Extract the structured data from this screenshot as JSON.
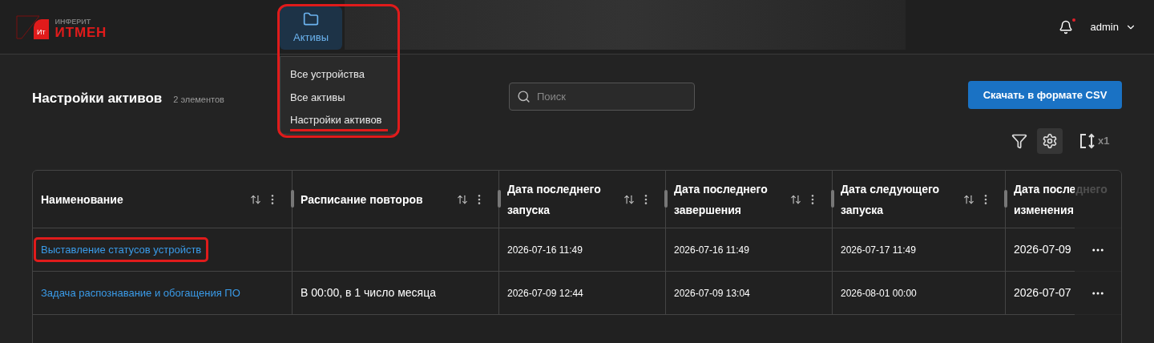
{
  "logo": {
    "badge": "Ит",
    "overline": "ИНФЕРИТ",
    "name": "ИТМЕН"
  },
  "nav": {
    "label": "Активы",
    "selected": true,
    "highlighted": true,
    "menu": [
      {
        "label": "Все устройства",
        "selected": false
      },
      {
        "label": "Все активы",
        "selected": false
      },
      {
        "label": "Настройки активов",
        "selected": true
      }
    ]
  },
  "user": {
    "name": "admin",
    "notification": true
  },
  "page": {
    "title": "Настройки активов",
    "count": "2 элементов"
  },
  "search": {
    "placeholder": "Поиск"
  },
  "csv_button": "Скачать в формате CSV",
  "toolbar": {
    "density": "x1",
    "settings_selected": true
  },
  "table": {
    "columns": [
      "Наименование",
      "Расписание повторов",
      "Дата последнего запуска",
      "Дата последнего завершения",
      "Дата следующего запуска",
      "Дата последнего изменения"
    ],
    "rows": [
      {
        "cells": [
          "Выставление статусов устройств",
          "",
          "2026-07-16 11:49",
          "2026-07-16 11:49",
          "2026-07-17 11:49",
          "2026-07-09"
        ],
        "highlighted": true
      },
      {
        "cells": [
          "Задача распознавание и обогащения ПО",
          "В 00:00, в 1 число месяца",
          "2026-07-09 12:44",
          "2026-07-09 13:04",
          "2026-08-01 00:00",
          "2026-07-07"
        ],
        "highlighted": false
      }
    ]
  }
}
